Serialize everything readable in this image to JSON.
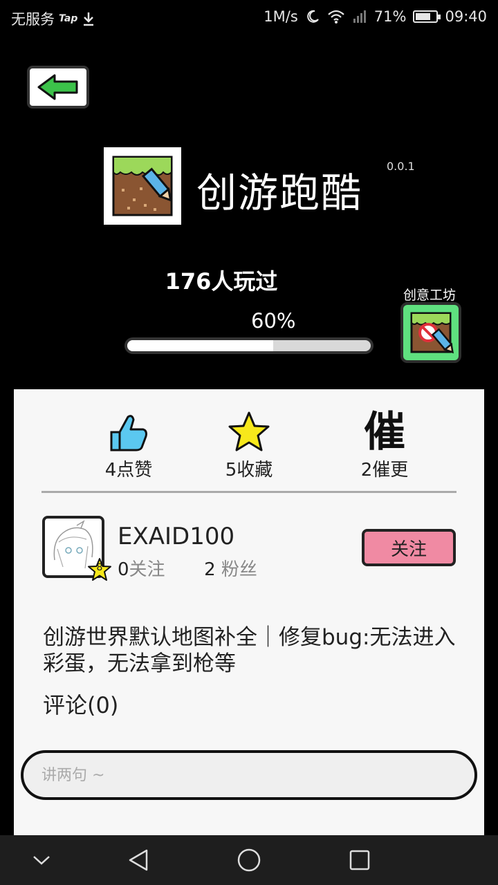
{
  "status_bar": {
    "carrier": "无服务",
    "tap": "Tap",
    "speed": "1M/s",
    "battery_pct": "71%",
    "battery_level": 0.71,
    "time": "09:40"
  },
  "game": {
    "title": "创游跑酷",
    "version": "0.0.1",
    "played": "176人玩过",
    "progress_label": "60%",
    "progress_value": 0.6,
    "workshop_label": "创意工坊"
  },
  "stats": {
    "likes": "4点赞",
    "favorites": "5收藏",
    "urge_glyph": "催",
    "urge": "2催更"
  },
  "author": {
    "name": "EXAID100",
    "level": "8",
    "following_count": "0",
    "following_label": "关注",
    "followers_count": "2",
    "followers_label": "粉丝",
    "follow_button": "关注"
  },
  "description": "创游世界默认地图补全｜修复bug:无法进入彩蛋，无法拿到枪等",
  "comments_label": "评论(0)",
  "comment_input": {
    "placeholder": "讲两句 ~"
  },
  "colors": {
    "accent_green": "#5fe07f",
    "follow_pink": "#f08aa3",
    "like_blue": "#5bc8f0",
    "star_yellow": "#f7e81b",
    "back_arrow_green": "#3cc24a"
  }
}
